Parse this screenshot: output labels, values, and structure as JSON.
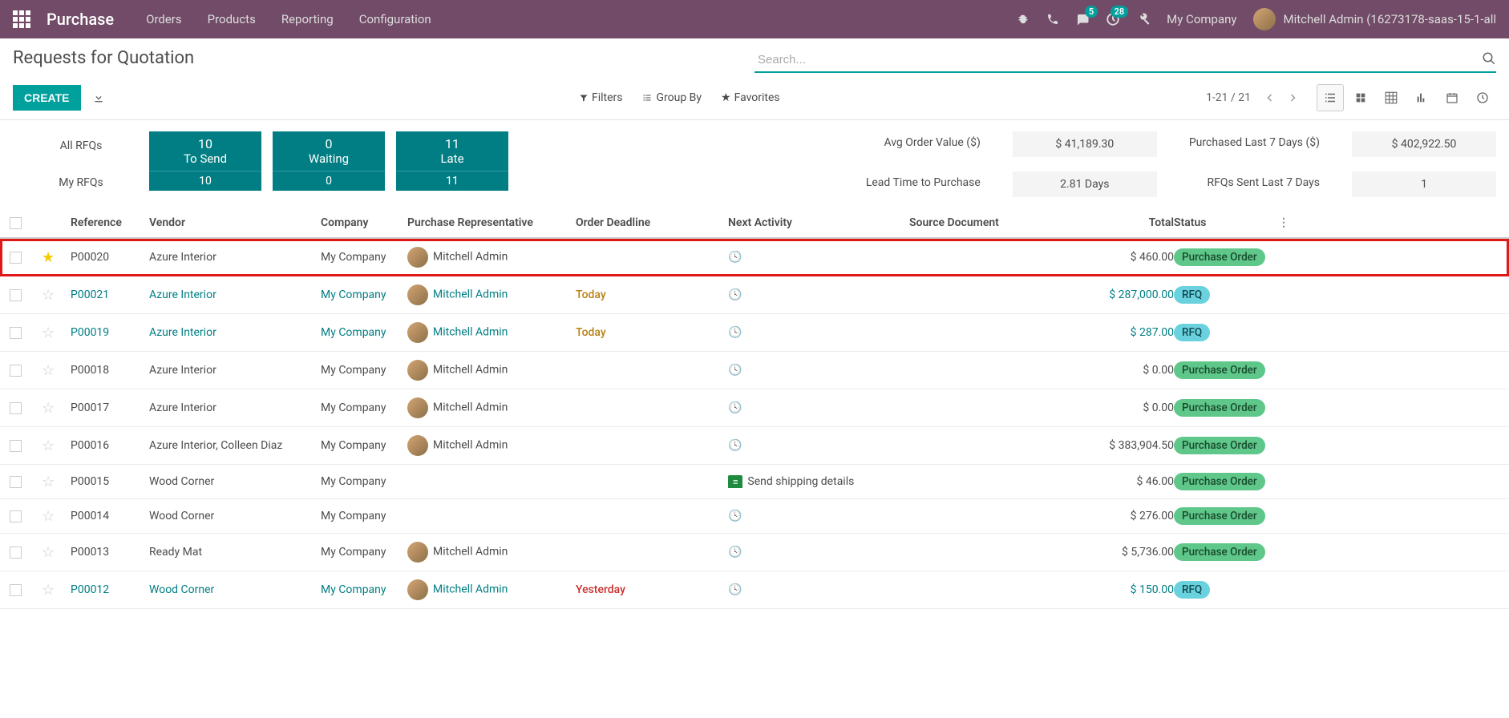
{
  "nav": {
    "brand": "Purchase",
    "menu": [
      "Orders",
      "Products",
      "Reporting",
      "Configuration"
    ],
    "msg_badge": "5",
    "act_badge": "28",
    "company": "My Company",
    "user": "Mitchell Admin (16273178-saas-15-1-all"
  },
  "breadcrumb": "Requests for Quotation",
  "search_placeholder": "Search...",
  "buttons": {
    "create": "CREATE"
  },
  "filters": {
    "filters": "Filters",
    "groupby": "Group By",
    "favorites": "Favorites"
  },
  "pager": "1-21 / 21",
  "dashboard": {
    "all_label": "All RFQs",
    "my_label": "My RFQs",
    "tiles_top": [
      {
        "num": "10",
        "label": "To Send"
      },
      {
        "num": "0",
        "label": "Waiting"
      },
      {
        "num": "11",
        "label": "Late"
      }
    ],
    "tiles_bottom": [
      "10",
      "0",
      "11"
    ],
    "stats": [
      {
        "label": "Avg Order Value ($)",
        "value": "$ 41,189.30"
      },
      {
        "label": "Lead Time to Purchase",
        "value": "2.81  Days"
      },
      {
        "label": "Purchased Last 7 Days ($)",
        "value": "$ 402,922.50"
      },
      {
        "label": "RFQs Sent Last 7 Days",
        "value": "1"
      }
    ]
  },
  "columns": {
    "reference": "Reference",
    "vendor": "Vendor",
    "company": "Company",
    "rep": "Purchase Representative",
    "deadline": "Order Deadline",
    "activity": "Next Activity",
    "source": "Source Document",
    "total": "Total",
    "status": "Status"
  },
  "rows": [
    {
      "star": true,
      "ref": "P00020",
      "vendor": "Azure Interior",
      "company": "My Company",
      "rep": "Mitchell Admin",
      "deadline": "",
      "activity": "",
      "total": "$ 460.00",
      "status": "Purchase Order",
      "status_type": "po",
      "link": false,
      "highlight": true
    },
    {
      "star": false,
      "ref": "P00021",
      "vendor": "Azure Interior",
      "company": "My Company",
      "rep": "Mitchell Admin",
      "deadline": "Today",
      "activity": "",
      "total": "$ 287,000.00",
      "status": "RFQ",
      "status_type": "rfq",
      "link": true
    },
    {
      "star": false,
      "ref": "P00019",
      "vendor": "Azure Interior",
      "company": "My Company",
      "rep": "Mitchell Admin",
      "deadline": "Today",
      "activity": "",
      "total": "$ 287.00",
      "status": "RFQ",
      "status_type": "rfq",
      "link": true
    },
    {
      "star": false,
      "ref": "P00018",
      "vendor": "Azure Interior",
      "company": "My Company",
      "rep": "Mitchell Admin",
      "deadline": "",
      "activity": "",
      "total": "$ 0.00",
      "status": "Purchase Order",
      "status_type": "po",
      "link": false
    },
    {
      "star": false,
      "ref": "P00017",
      "vendor": "Azure Interior",
      "company": "My Company",
      "rep": "Mitchell Admin",
      "deadline": "",
      "activity": "",
      "total": "$ 0.00",
      "status": "Purchase Order",
      "status_type": "po",
      "link": false
    },
    {
      "star": false,
      "ref": "P00016",
      "vendor": "Azure Interior, Colleen Diaz",
      "company": "My Company",
      "rep": "Mitchell Admin",
      "deadline": "",
      "activity": "",
      "total": "$ 383,904.50",
      "status": "Purchase Order",
      "status_type": "po",
      "link": false
    },
    {
      "star": false,
      "ref": "P00015",
      "vendor": "Wood Corner",
      "company": "My Company",
      "rep": "",
      "deadline": "",
      "activity": "Send shipping details",
      "activity_badge": true,
      "total": "$ 46.00",
      "status": "Purchase Order",
      "status_type": "po",
      "link": false
    },
    {
      "star": false,
      "ref": "P00014",
      "vendor": "Wood Corner",
      "company": "My Company",
      "rep": "",
      "deadline": "",
      "activity": "",
      "total": "$ 276.00",
      "status": "Purchase Order",
      "status_type": "po",
      "link": false
    },
    {
      "star": false,
      "ref": "P00013",
      "vendor": "Ready Mat",
      "company": "My Company",
      "rep": "Mitchell Admin",
      "deadline": "",
      "activity": "",
      "total": "$ 5,736.00",
      "status": "Purchase Order",
      "status_type": "po",
      "link": false
    },
    {
      "star": false,
      "ref": "P00012",
      "vendor": "Wood Corner",
      "company": "My Company",
      "rep": "Mitchell Admin",
      "deadline": "Yesterday",
      "deadline_past": true,
      "activity": "",
      "total": "$ 150.00",
      "status": "RFQ",
      "status_type": "rfq",
      "link": true
    }
  ]
}
